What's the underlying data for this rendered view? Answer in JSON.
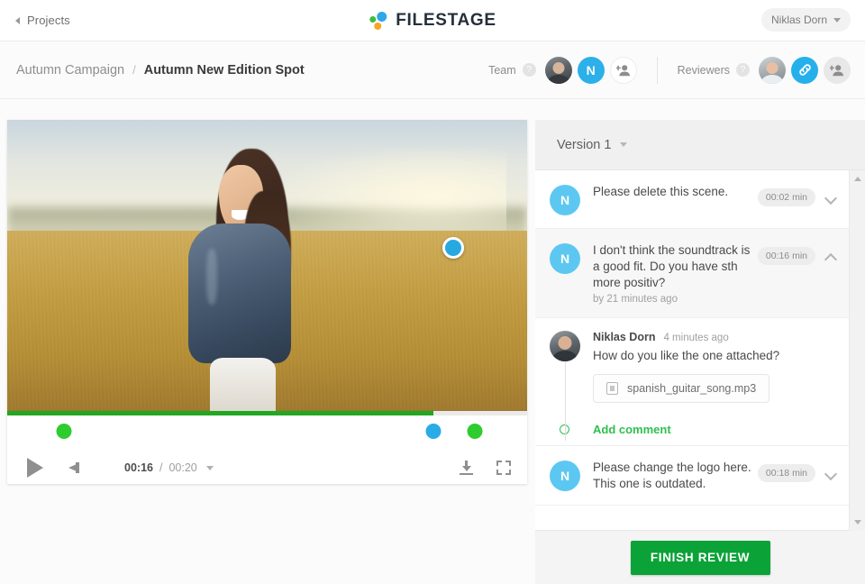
{
  "topbar": {
    "back_label": "Projects",
    "back_icon": "caret-left-icon",
    "logo_text": "FILESTAGE",
    "logo_colors": {
      "blue": "#2fa8e8",
      "green": "#3bbf3b",
      "orange": "#f5a623"
    },
    "user_name": "Niklas Dorn",
    "user_caret_icon": "chevron-down-icon"
  },
  "breadcrumb": {
    "parent": "Autumn Campaign",
    "separator": "/",
    "current": "Autumn New Edition Spot"
  },
  "team": {
    "label": "Team",
    "help_icon": "question-mark-icon",
    "members": [
      {
        "type": "photo",
        "name": "team-member-photo"
      },
      {
        "type": "initial",
        "initial": "N",
        "name": "team-member-niklas"
      }
    ],
    "add_icon": "add-person-icon"
  },
  "reviewers": {
    "label": "Reviewers",
    "help_icon": "question-mark-icon",
    "members": [
      {
        "type": "photo",
        "name": "reviewer-photo"
      }
    ],
    "link_icon": "link-icon",
    "add_icon": "add-person-icon"
  },
  "player": {
    "marker_icon": "comment-marker-icon",
    "play_icon": "play-icon",
    "volume_icon": "volume-icon",
    "download_icon": "download-icon",
    "fullscreen_icon": "fullscreen-icon",
    "speed_caret_icon": "chevron-down-icon",
    "current_time": "00:16",
    "time_separator": "/",
    "total_time": "00:20",
    "progress_percent": 82,
    "progress_color": "#22a722",
    "timeline_markers": [
      {
        "position_percent": 11,
        "color": "#2fcc2f",
        "name": "timeline-marker-1"
      },
      {
        "position_percent": 82,
        "color": "#29abe8",
        "name": "timeline-marker-2"
      },
      {
        "position_percent": 90,
        "color": "#2fcc2f",
        "name": "timeline-marker-3"
      }
    ]
  },
  "panel": {
    "version_label": "Version 1",
    "version_caret_icon": "chevron-down-icon",
    "scroll_up_icon": "scroll-up-arrow-icon",
    "scroll_down_icon": "scroll-down-arrow-icon",
    "finish_label": "FINISH REVIEW",
    "finish_color": "#0ba237"
  },
  "comments": [
    {
      "avatar_initial": "N",
      "text": "Please delete this scene.",
      "timecode": "00:02 min",
      "chevron": "chevron-down-icon",
      "expanded": false,
      "meta": ""
    },
    {
      "avatar_initial": "N",
      "text": "I don't think the soundtrack is a good fit. Do you have sth more positiv?",
      "meta": "by 21 minutes ago",
      "timecode": "00:16 min",
      "chevron": "chevron-up-icon",
      "expanded": true
    },
    {
      "avatar_initial": "N",
      "text": "Please change the logo here. This one is outdated.",
      "timecode": "00:18 min",
      "chevron": "chevron-down-icon",
      "expanded": false,
      "meta": ""
    }
  ],
  "thread": {
    "reply": {
      "author": "Niklas Dorn",
      "time": "4 minutes ago",
      "text": "How do you like the one attached?",
      "attachment": {
        "icon": "file-media-icon",
        "filename": "spanish_guitar_song.mp3"
      }
    },
    "add_comment_label": "Add comment",
    "add_comment_icon": "circle-outline-icon",
    "add_comment_color": "#2fbf4f"
  }
}
